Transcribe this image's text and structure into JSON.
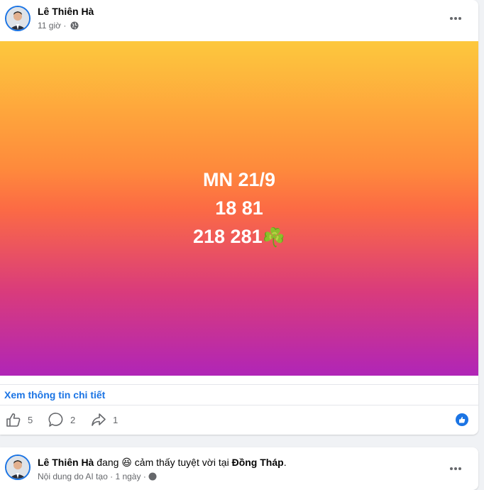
{
  "post1": {
    "author": "Lê Thiên Hà",
    "time": "11 giờ",
    "separator": "·",
    "privacy_icon": "globe-icon",
    "content_lines": [
      "MN 21/9",
      "18 81",
      "218 281"
    ],
    "content_emoji": "☘️",
    "details_link": "Xem thông tin chi tiết",
    "reactions": {
      "like_count": "5",
      "comment_count": "2",
      "share_count": "1"
    },
    "colors": {
      "accent": "#1b74e4",
      "gradient_top": "#fdc83d",
      "gradient_mid": "#fc6b44",
      "gradient_bottom": "#b025b7"
    }
  },
  "post2": {
    "author": "Lê Thiên Hà",
    "status_prefix": "đang",
    "status_emoji": "😆",
    "status_text": "cảm thấy tuyệt vời tại",
    "location": "Đồng Tháp",
    "period": ".",
    "ai_note": "Nội dung do AI tạo",
    "time": "1 ngày",
    "separator": "·",
    "privacy_icon": "globe-icon"
  }
}
